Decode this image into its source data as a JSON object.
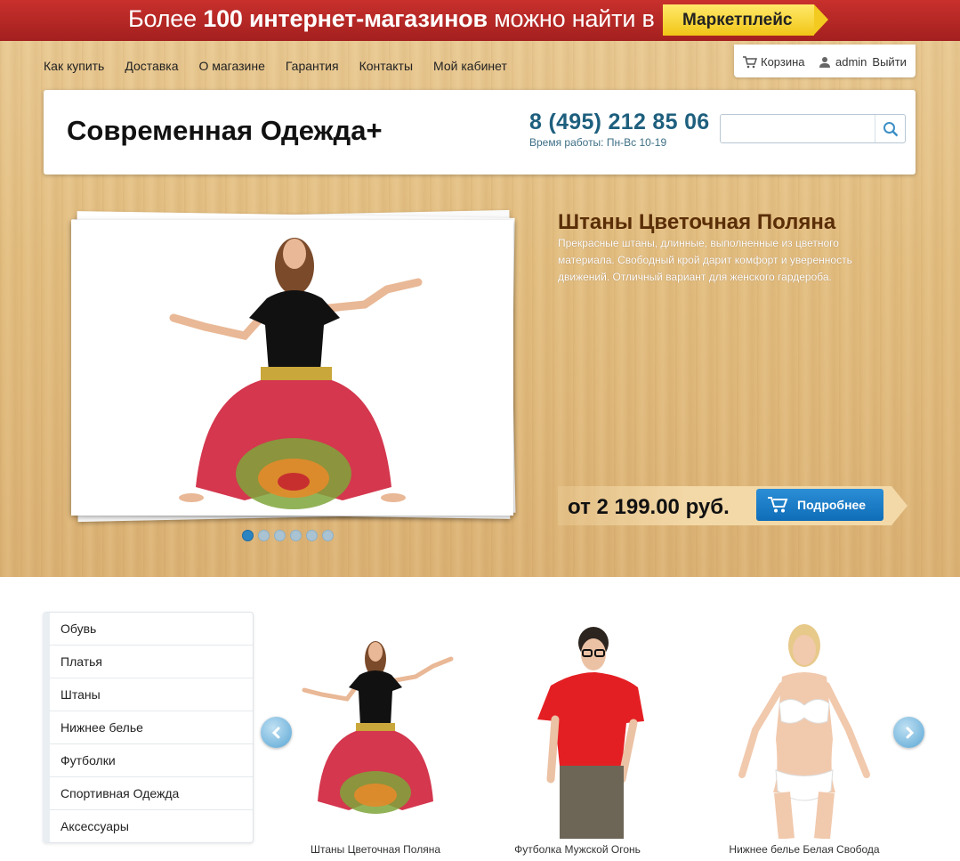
{
  "banner": {
    "text_before": "Более",
    "text_bold": "100 интернет-магазинов",
    "text_after": "можно найти в",
    "button_label": "Маркетплейс"
  },
  "nav": {
    "items": [
      "Как купить",
      "Доставка",
      "О магазине",
      "Гарантия",
      "Контакты",
      "Мой кабинет"
    ]
  },
  "userbox": {
    "cart_label": "Корзина",
    "user_label": "admin",
    "logout_label": "Выйти"
  },
  "header": {
    "logo": "Современная Одежда+",
    "phone": "8 (495) 212 85 06",
    "hours": "Время работы: Пн-Вс 10-19",
    "search_placeholder": ""
  },
  "slider": {
    "title": "Штаны Цветочная Поляна",
    "description": "Прекрасные штаны, длинные, выполненные из цветного материала. Свободный крой дарит комфорт и уверенность движений. Отличный вариант для женского гардероба.",
    "price": "от 2 199.00 руб.",
    "button_label": "Подробнее",
    "dots_count": 6,
    "active_dot": 1
  },
  "categories": [
    "Обувь",
    "Платья",
    "Штаны",
    "Нижнее белье",
    "Футболки",
    "Спортивная Одежда",
    "Аксессуары"
  ],
  "products": [
    {
      "name": "Штаны Цветочная Поляна"
    },
    {
      "name": "Футболка Мужской Огонь"
    },
    {
      "name": "Нижнее белье Белая Свобода"
    }
  ],
  "colors": {
    "banner_red": "#b4282a",
    "accent_blue": "#1578c2",
    "phone_blue": "#1e5f7e",
    "title_brown": "#5a2e07"
  },
  "icons": [
    "cart-icon",
    "user-icon",
    "search-icon",
    "arrow-left-icon",
    "arrow-right-icon"
  ]
}
